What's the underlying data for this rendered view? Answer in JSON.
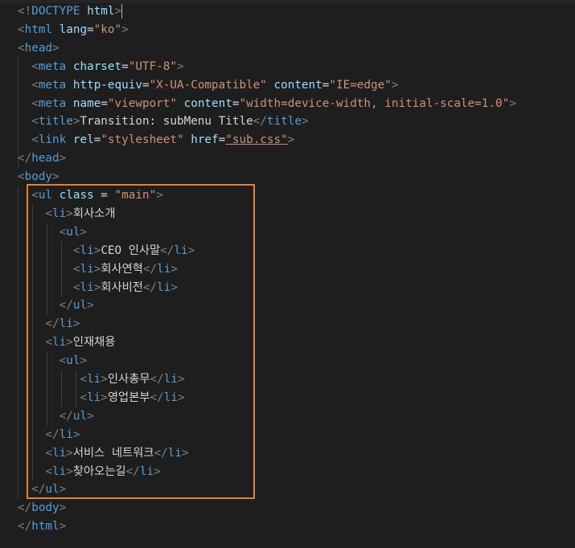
{
  "editor": {
    "highlight_color": "#e0823a",
    "lines": [
      [
        {
          "t": "<!",
          "c": "punct"
        },
        {
          "t": "DOCTYPE",
          "c": "tag"
        },
        {
          "t": " ",
          "c": "text"
        },
        {
          "t": "html",
          "c": "attr"
        },
        {
          "t": ">",
          "c": "punct"
        }
      ],
      [
        {
          "t": "<",
          "c": "punct"
        },
        {
          "t": "html",
          "c": "tag"
        },
        {
          "t": " ",
          "c": "text"
        },
        {
          "t": "lang",
          "c": "attr"
        },
        {
          "t": "=",
          "c": "text"
        },
        {
          "t": "\"ko\"",
          "c": "str"
        },
        {
          "t": ">",
          "c": "punct"
        }
      ],
      [
        {
          "t": "<",
          "c": "punct"
        },
        {
          "t": "head",
          "c": "tag"
        },
        {
          "t": ">",
          "c": "punct"
        }
      ],
      [
        {
          "t": "  ",
          "c": "text"
        },
        {
          "t": "<",
          "c": "punct"
        },
        {
          "t": "meta",
          "c": "tag"
        },
        {
          "t": " ",
          "c": "text"
        },
        {
          "t": "charset",
          "c": "attr"
        },
        {
          "t": "=",
          "c": "text"
        },
        {
          "t": "\"UTF-8\"",
          "c": "str"
        },
        {
          "t": ">",
          "c": "punct"
        }
      ],
      [
        {
          "t": "  ",
          "c": "text"
        },
        {
          "t": "<",
          "c": "punct"
        },
        {
          "t": "meta",
          "c": "tag"
        },
        {
          "t": " ",
          "c": "text"
        },
        {
          "t": "http-equiv",
          "c": "attr"
        },
        {
          "t": "=",
          "c": "text"
        },
        {
          "t": "\"X-UA-Compatible\"",
          "c": "str"
        },
        {
          "t": " ",
          "c": "text"
        },
        {
          "t": "content",
          "c": "attr"
        },
        {
          "t": "=",
          "c": "text"
        },
        {
          "t": "\"IE=edge\"",
          "c": "str"
        },
        {
          "t": ">",
          "c": "punct"
        }
      ],
      [
        {
          "t": "  ",
          "c": "text"
        },
        {
          "t": "<",
          "c": "punct"
        },
        {
          "t": "meta",
          "c": "tag"
        },
        {
          "t": " ",
          "c": "text"
        },
        {
          "t": "name",
          "c": "attr"
        },
        {
          "t": "=",
          "c": "text"
        },
        {
          "t": "\"viewport\"",
          "c": "str"
        },
        {
          "t": " ",
          "c": "text"
        },
        {
          "t": "content",
          "c": "attr"
        },
        {
          "t": "=",
          "c": "text"
        },
        {
          "t": "\"width=device-width, initial-scale=1.0\"",
          "c": "str"
        },
        {
          "t": ">",
          "c": "punct"
        }
      ],
      [
        {
          "t": "  ",
          "c": "text"
        },
        {
          "t": "<",
          "c": "punct"
        },
        {
          "t": "title",
          "c": "tag"
        },
        {
          "t": ">",
          "c": "punct"
        },
        {
          "t": "Transition: subMenu Title",
          "c": "text"
        },
        {
          "t": "</",
          "c": "punct"
        },
        {
          "t": "title",
          "c": "tag"
        },
        {
          "t": ">",
          "c": "punct"
        }
      ],
      [
        {
          "t": "  ",
          "c": "text"
        },
        {
          "t": "<",
          "c": "punct"
        },
        {
          "t": "link",
          "c": "tag"
        },
        {
          "t": " ",
          "c": "text"
        },
        {
          "t": "rel",
          "c": "attr"
        },
        {
          "t": "=",
          "c": "text"
        },
        {
          "t": "\"stylesheet\"",
          "c": "str"
        },
        {
          "t": " ",
          "c": "text"
        },
        {
          "t": "href",
          "c": "attr"
        },
        {
          "t": "=",
          "c": "text"
        },
        {
          "t": "\"sub.css\"",
          "c": "str"
        },
        {
          "t": ">",
          "c": "punct"
        }
      ],
      [
        {
          "t": "</",
          "c": "punct"
        },
        {
          "t": "head",
          "c": "tag"
        },
        {
          "t": ">",
          "c": "punct"
        }
      ],
      [
        {
          "t": "<",
          "c": "punct"
        },
        {
          "t": "body",
          "c": "tag"
        },
        {
          "t": ">",
          "c": "punct"
        }
      ],
      [
        {
          "t": "  ",
          "c": "text"
        },
        {
          "t": "<",
          "c": "punct"
        },
        {
          "t": "ul",
          "c": "tag"
        },
        {
          "t": " ",
          "c": "text"
        },
        {
          "t": "class",
          "c": "attr"
        },
        {
          "t": " = ",
          "c": "text"
        },
        {
          "t": "\"main\"",
          "c": "str"
        },
        {
          "t": ">",
          "c": "punct"
        }
      ],
      [
        {
          "t": "    ",
          "c": "text"
        },
        {
          "t": "<",
          "c": "punct"
        },
        {
          "t": "li",
          "c": "tag"
        },
        {
          "t": ">",
          "c": "punct"
        },
        {
          "t": "회사소개",
          "c": "text"
        }
      ],
      [
        {
          "t": "      ",
          "c": "text"
        },
        {
          "t": "<",
          "c": "punct"
        },
        {
          "t": "ul",
          "c": "tag"
        },
        {
          "t": ">",
          "c": "punct"
        }
      ],
      [
        {
          "t": "        ",
          "c": "text"
        },
        {
          "t": "<",
          "c": "punct"
        },
        {
          "t": "li",
          "c": "tag"
        },
        {
          "t": ">",
          "c": "punct"
        },
        {
          "t": "CEO 인사말",
          "c": "text"
        },
        {
          "t": "</",
          "c": "punct"
        },
        {
          "t": "li",
          "c": "tag"
        },
        {
          "t": ">",
          "c": "punct"
        }
      ],
      [
        {
          "t": "        ",
          "c": "text"
        },
        {
          "t": "<",
          "c": "punct"
        },
        {
          "t": "li",
          "c": "tag"
        },
        {
          "t": ">",
          "c": "punct"
        },
        {
          "t": "회사연혁",
          "c": "text"
        },
        {
          "t": "</",
          "c": "punct"
        },
        {
          "t": "li",
          "c": "tag"
        },
        {
          "t": ">",
          "c": "punct"
        }
      ],
      [
        {
          "t": "        ",
          "c": "text"
        },
        {
          "t": "<",
          "c": "punct"
        },
        {
          "t": "li",
          "c": "tag"
        },
        {
          "t": ">",
          "c": "punct"
        },
        {
          "t": "회사비전",
          "c": "text"
        },
        {
          "t": "</",
          "c": "punct"
        },
        {
          "t": "li",
          "c": "tag"
        },
        {
          "t": ">",
          "c": "punct"
        }
      ],
      [
        {
          "t": "      ",
          "c": "text"
        },
        {
          "t": "</",
          "c": "punct"
        },
        {
          "t": "ul",
          "c": "tag"
        },
        {
          "t": ">",
          "c": "punct"
        }
      ],
      [
        {
          "t": "    ",
          "c": "text"
        },
        {
          "t": "</",
          "c": "punct"
        },
        {
          "t": "li",
          "c": "tag"
        },
        {
          "t": ">",
          "c": "punct"
        }
      ],
      [
        {
          "t": "    ",
          "c": "text"
        },
        {
          "t": "<",
          "c": "punct"
        },
        {
          "t": "li",
          "c": "tag"
        },
        {
          "t": ">",
          "c": "punct"
        },
        {
          "t": "인재채용",
          "c": "text"
        }
      ],
      [
        {
          "t": "      ",
          "c": "text"
        },
        {
          "t": "<",
          "c": "punct"
        },
        {
          "t": "ul",
          "c": "tag"
        },
        {
          "t": ">",
          "c": "punct"
        }
      ],
      [
        {
          "t": "         ",
          "c": "text"
        },
        {
          "t": "<",
          "c": "punct"
        },
        {
          "t": "li",
          "c": "tag"
        },
        {
          "t": ">",
          "c": "punct"
        },
        {
          "t": "인사총무",
          "c": "text"
        },
        {
          "t": "</",
          "c": "punct"
        },
        {
          "t": "li",
          "c": "tag"
        },
        {
          "t": ">",
          "c": "punct"
        }
      ],
      [
        {
          "t": "         ",
          "c": "text"
        },
        {
          "t": "<",
          "c": "punct"
        },
        {
          "t": "li",
          "c": "tag"
        },
        {
          "t": ">",
          "c": "punct"
        },
        {
          "t": "영업본부",
          "c": "text"
        },
        {
          "t": "</",
          "c": "punct"
        },
        {
          "t": "li",
          "c": "tag"
        },
        {
          "t": ">",
          "c": "punct"
        }
      ],
      [
        {
          "t": "      ",
          "c": "text"
        },
        {
          "t": "</",
          "c": "punct"
        },
        {
          "t": "ul",
          "c": "tag"
        },
        {
          "t": ">",
          "c": "punct"
        }
      ],
      [
        {
          "t": "    ",
          "c": "text"
        },
        {
          "t": "</",
          "c": "punct"
        },
        {
          "t": "li",
          "c": "tag"
        },
        {
          "t": ">",
          "c": "punct"
        }
      ],
      [
        {
          "t": "    ",
          "c": "text"
        },
        {
          "t": "<",
          "c": "punct"
        },
        {
          "t": "li",
          "c": "tag"
        },
        {
          "t": ">",
          "c": "punct"
        },
        {
          "t": "서비스 네트워크",
          "c": "text"
        },
        {
          "t": "</",
          "c": "punct"
        },
        {
          "t": "li",
          "c": "tag"
        },
        {
          "t": ">",
          "c": "punct"
        }
      ],
      [
        {
          "t": "    ",
          "c": "text"
        },
        {
          "t": "<",
          "c": "punct"
        },
        {
          "t": "li",
          "c": "tag"
        },
        {
          "t": ">",
          "c": "punct"
        },
        {
          "t": "찾아오는길",
          "c": "text"
        },
        {
          "t": "</",
          "c": "punct"
        },
        {
          "t": "li",
          "c": "tag"
        },
        {
          "t": ">",
          "c": "punct"
        }
      ],
      [
        {
          "t": "  ",
          "c": "text"
        },
        {
          "t": "</",
          "c": "punct"
        },
        {
          "t": "ul",
          "c": "tag"
        },
        {
          "t": ">",
          "c": "punct"
        }
      ],
      [
        {
          "t": "</",
          "c": "punct"
        },
        {
          "t": "body",
          "c": "tag"
        },
        {
          "t": ">",
          "c": "punct"
        }
      ],
      [
        {
          "t": "</",
          "c": "punct"
        },
        {
          "t": "html",
          "c": "tag"
        },
        {
          "t": ">",
          "c": "punct"
        }
      ]
    ]
  }
}
